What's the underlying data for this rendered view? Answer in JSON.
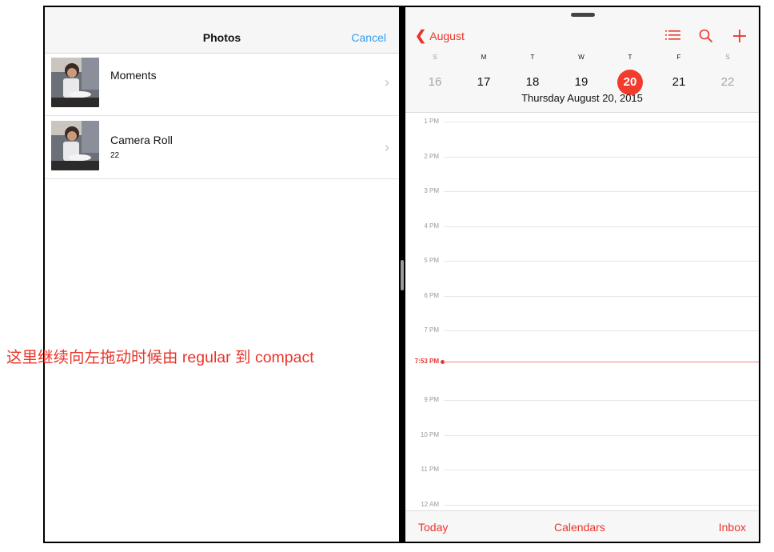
{
  "photos": {
    "title": "Photos",
    "cancel_label": "Cancel",
    "albums": [
      {
        "name": "Moments",
        "count": ""
      },
      {
        "name": "Camera Roll",
        "count": "22"
      }
    ]
  },
  "calendar": {
    "back_label": "August",
    "weekdays": [
      "S",
      "M",
      "T",
      "W",
      "T",
      "F",
      "S"
    ],
    "days": [
      "16",
      "17",
      "18",
      "19",
      "20",
      "21",
      "22"
    ],
    "selected_day": "20",
    "date_caption": "Thursday  August 20, 2015",
    "hours": [
      "1 PM",
      "2 PM",
      "3 PM",
      "4 PM",
      "5 PM",
      "6 PM",
      "7 PM",
      "9 PM",
      "10 PM",
      "11 PM",
      "12 AM"
    ],
    "now_label": "7:53 PM",
    "toolbar": {
      "today": "Today",
      "calendars": "Calendars",
      "inbox": "Inbox"
    },
    "icons": [
      "list-icon",
      "search-icon",
      "add-icon"
    ]
  },
  "annotation": "这里继续向左拖动时候由 regular 到 compact",
  "colors": {
    "accent_red": "#e8352b",
    "accent_blue": "#2f9df5",
    "today_circle": "#f23a2d"
  }
}
